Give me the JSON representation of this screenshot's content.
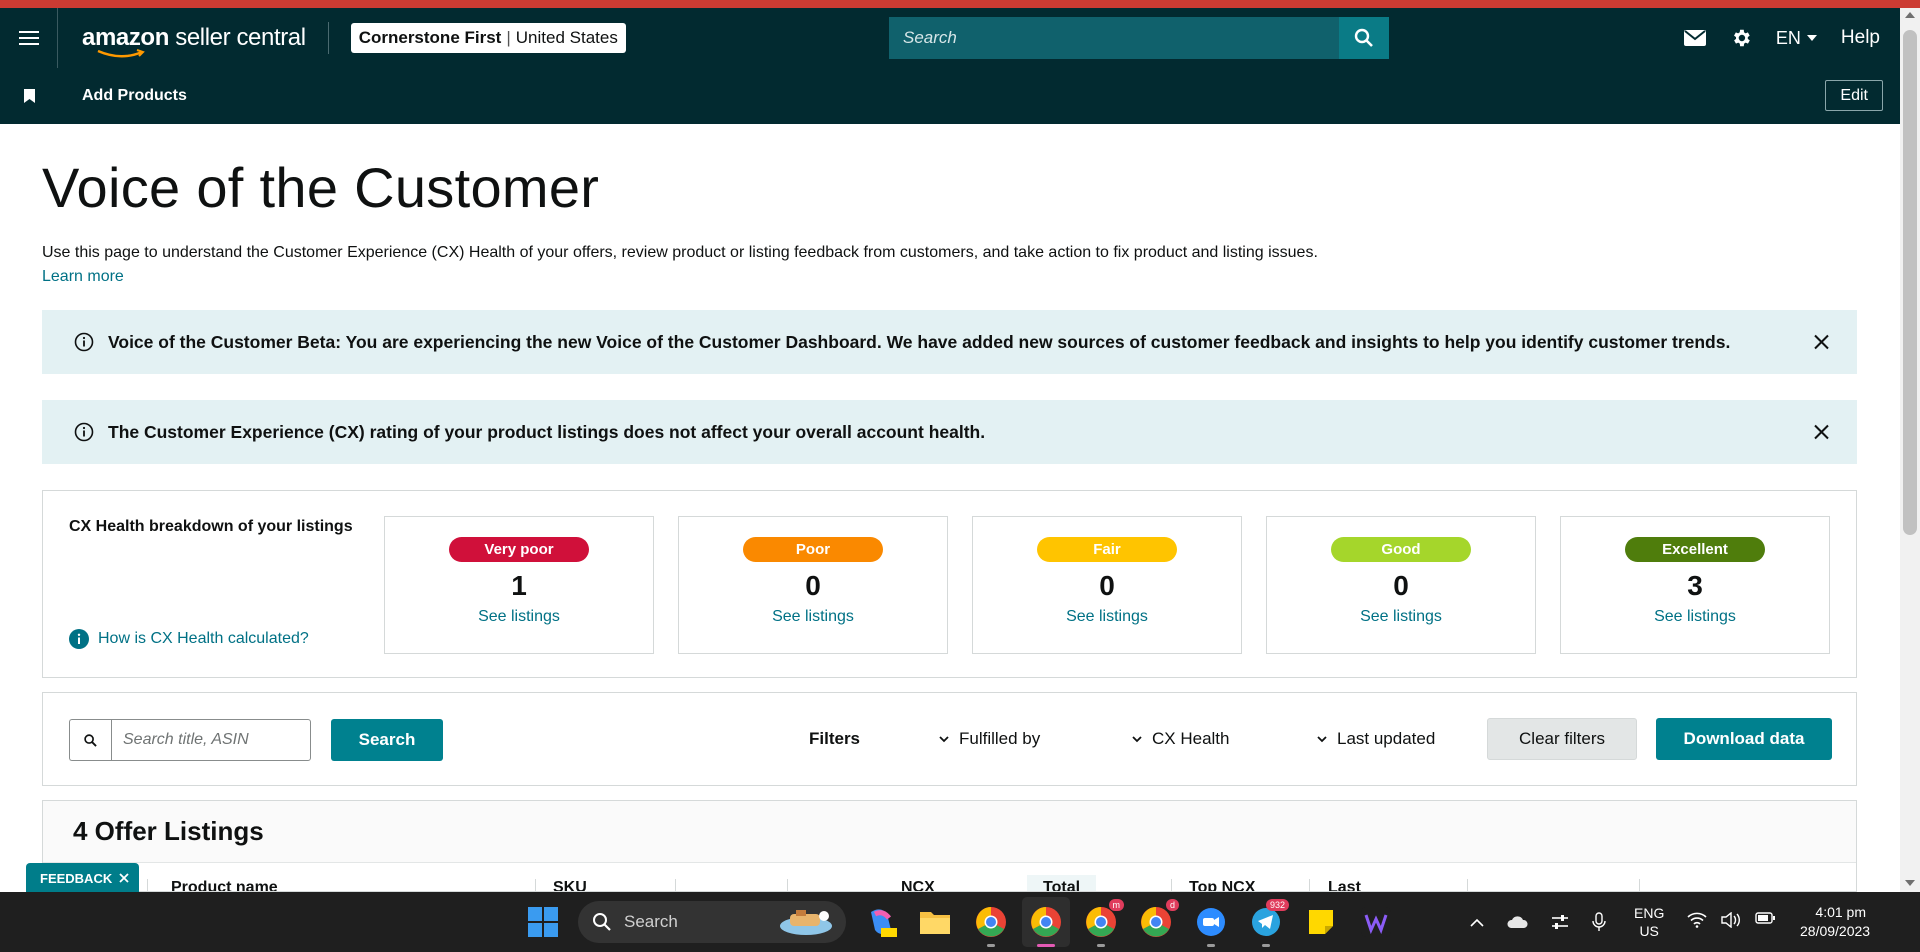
{
  "header": {
    "logo_bold": "amazon",
    "logo_rest": " seller central",
    "store_name": "Cornerstone First",
    "store_region": "United States",
    "search_placeholder": "Search",
    "language": "EN",
    "help_label": "Help"
  },
  "subnav": {
    "add_products_label": "Add Products",
    "edit_label": "Edit"
  },
  "page": {
    "title": "Voice of the Customer",
    "intro": "Use this page to understand the Customer Experience (CX) Health of your offers, review product or listing feedback from customers, and take action to fix product and listing issues.",
    "learn_more": "Learn more"
  },
  "alerts": [
    {
      "message": "Voice of the Customer Beta: You are experiencing the new Voice of the Customer Dashboard. We have added new sources of customer feedback and insights to help you identify customer trends."
    },
    {
      "message": "The Customer Experience (CX) rating of your product listings does not affect your overall account health."
    }
  ],
  "cx_health": {
    "title": "CX Health breakdown of your listings",
    "help_link": "How is CX Health calculated?",
    "cards": [
      {
        "label": "Very poor",
        "count": "1",
        "link": "See listings",
        "color": "#d0103a"
      },
      {
        "label": "Poor",
        "count": "0",
        "link": "See listings",
        "color": "#fa8900"
      },
      {
        "label": "Fair",
        "count": "0",
        "link": "See listings",
        "color": "#ffc400"
      },
      {
        "label": "Good",
        "count": "0",
        "link": "See listings",
        "color": "#a5d62b"
      },
      {
        "label": "Excellent",
        "count": "3",
        "link": "See listings",
        "color": "#4f7d0c"
      }
    ]
  },
  "filters": {
    "search_placeholder": "Search title, ASIN",
    "search_button": "Search",
    "filters_label": "Filters",
    "dropdowns": [
      "Fulfilled by",
      "CX Health",
      "Last updated"
    ],
    "clear_button": "Clear filters",
    "download_button": "Download data"
  },
  "listings": {
    "title": "4 Offer Listings",
    "columns": [
      "Product name",
      "SKU",
      "NCX",
      "Total",
      "Top NCX",
      "Last"
    ]
  },
  "feedback_tab": "FEEDBACK",
  "taskbar": {
    "search_label": "Search",
    "badge_m": "m",
    "badge_d": "d",
    "badge_telegram": "932",
    "lang_line1": "ENG",
    "lang_line2": "US",
    "time": "4:01 pm",
    "date": "28/09/2023"
  },
  "colors": {
    "header_bg": "#022a30",
    "accent_teal": "#00818f",
    "link": "#007185",
    "alert_bg": "#e3f1f3"
  }
}
